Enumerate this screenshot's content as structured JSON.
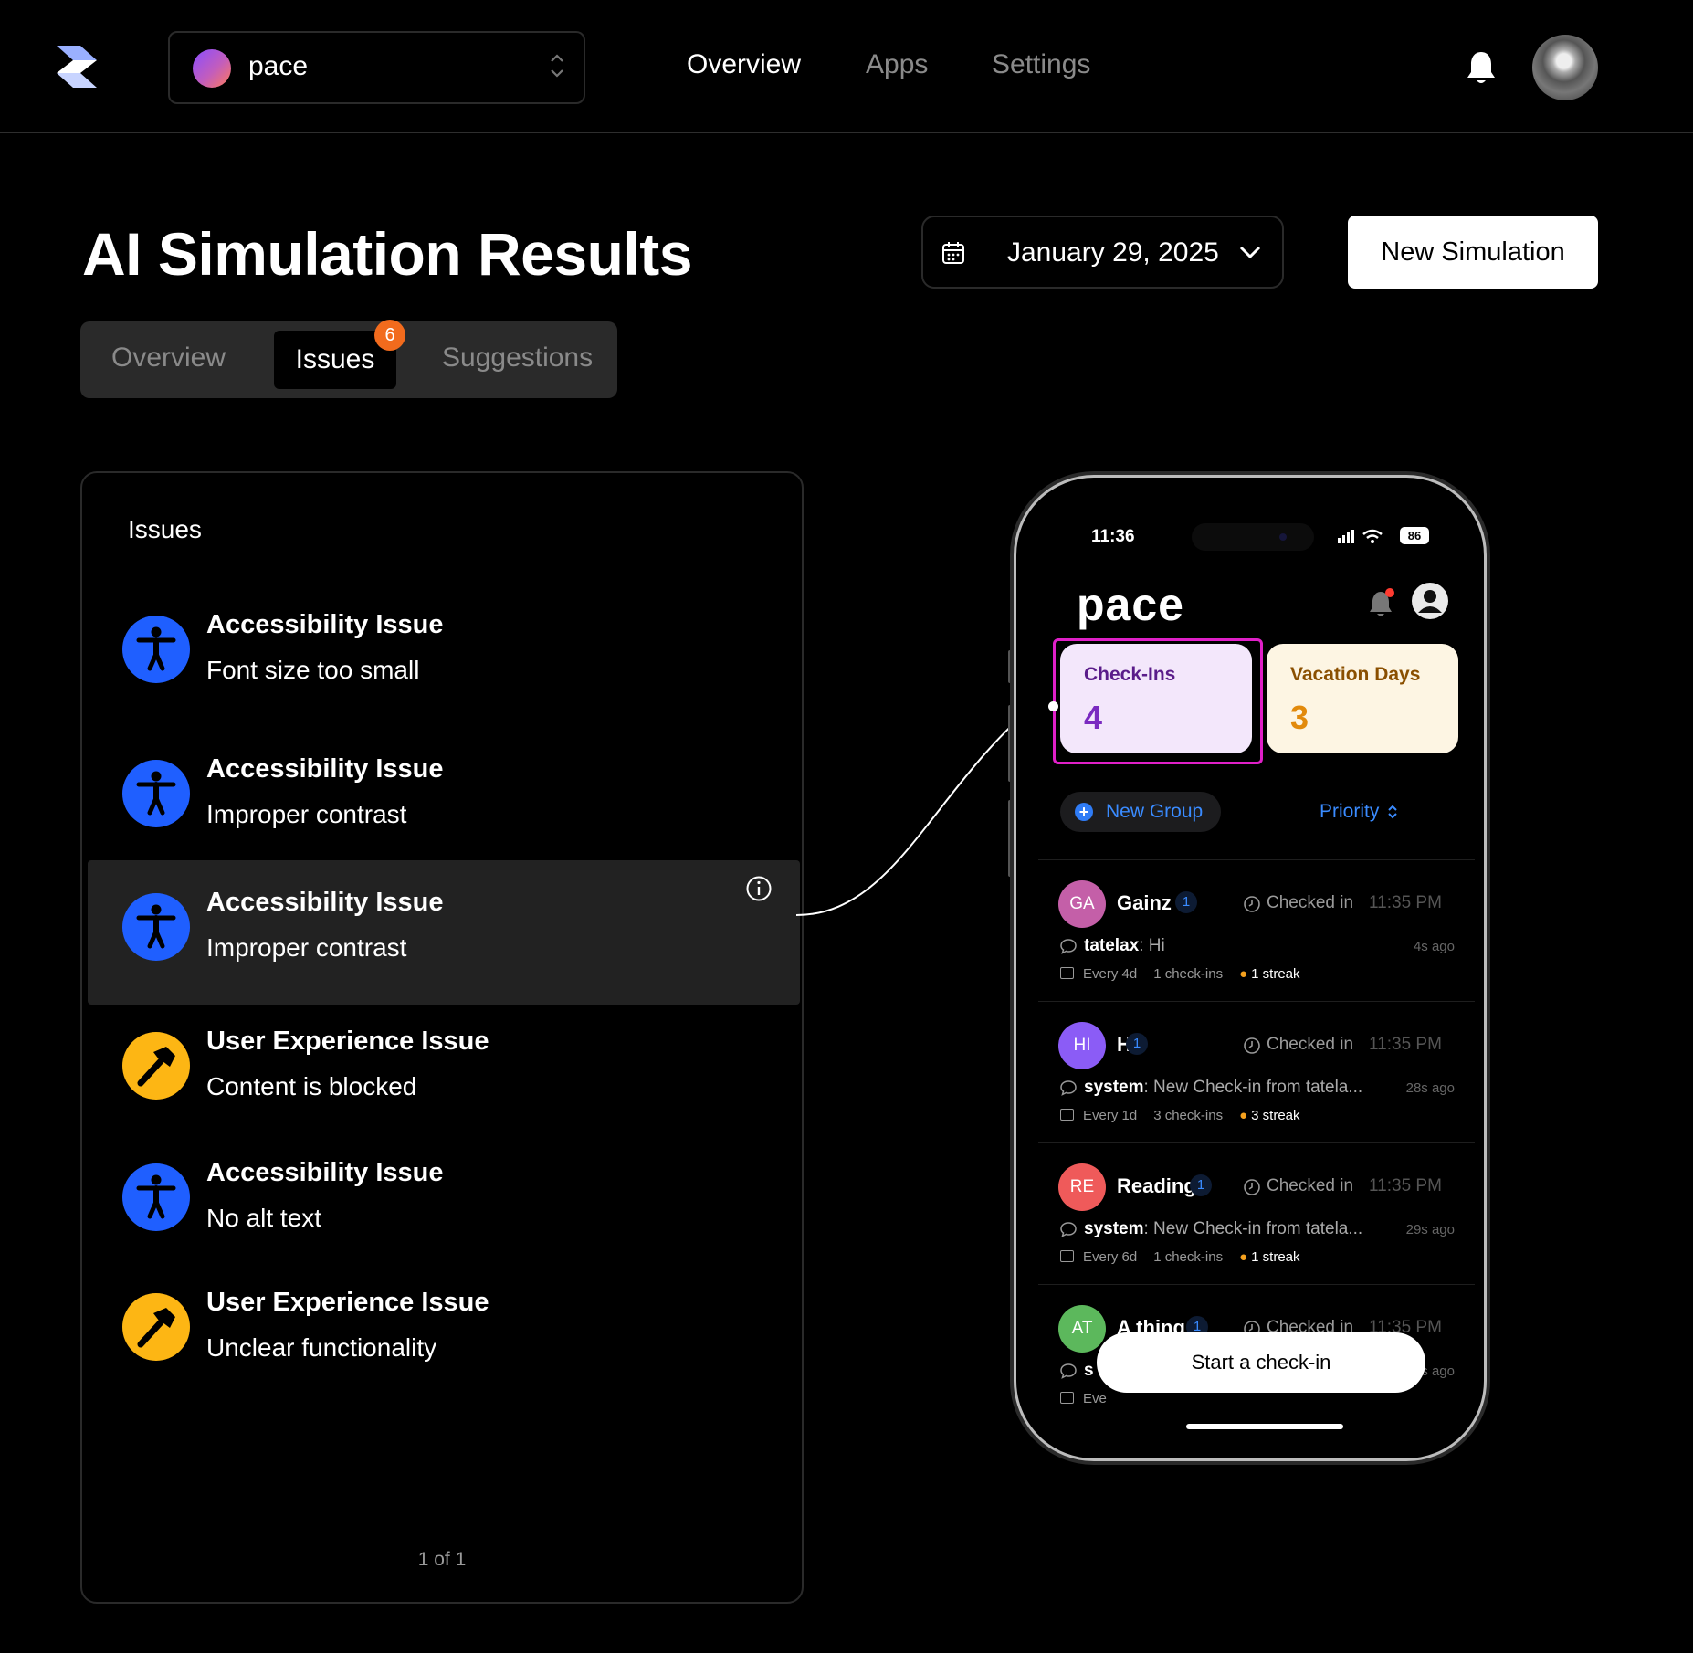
{
  "topbar": {
    "workspace_name": "pace",
    "nav": {
      "overview": "Overview",
      "apps": "Apps",
      "settings": "Settings"
    },
    "active_nav": "Overview"
  },
  "header": {
    "title": "AI Simulation Results",
    "date": "January 29, 2025",
    "new_simulation_label": "New Simulation"
  },
  "tabs": {
    "overview": "Overview",
    "issues": "Issues",
    "issues_badge": "6",
    "suggestions": "Suggestions",
    "active": "Issues"
  },
  "issues_panel": {
    "title": "Issues",
    "items": [
      {
        "type": "accessibility",
        "icon": "accessibility-icon",
        "title": "Accessibility Issue",
        "desc": "Font size too small"
      },
      {
        "type": "accessibility",
        "icon": "accessibility-icon",
        "title": "Accessibility Issue",
        "desc": "Improper contrast"
      },
      {
        "type": "accessibility",
        "icon": "accessibility-icon",
        "title": "Accessibility Issue",
        "desc": "Improper contrast",
        "selected": true
      },
      {
        "type": "ux",
        "icon": "hammer-icon",
        "title": "User Experience Issue",
        "desc": "Content is blocked"
      },
      {
        "type": "accessibility",
        "icon": "accessibility-icon",
        "title": "Accessibility Issue",
        "desc": "No alt text"
      },
      {
        "type": "ux",
        "icon": "hammer-icon",
        "title": "User Experience Issue",
        "desc": "Unclear functionality"
      }
    ],
    "pager": "1 of 1"
  },
  "phone": {
    "status_time": "11:36",
    "battery": "86",
    "app_name": "pace",
    "stats": {
      "checkins_label": "Check-Ins",
      "checkins_value": "4",
      "vacation_label": "Vacation Days",
      "vacation_value": "3"
    },
    "new_group_label": "New Group",
    "sort_label": "Priority",
    "groups": [
      {
        "initials": "GA",
        "name": "Gainz",
        "count": "1",
        "checked": "Checked in",
        "time": "11:35 PM",
        "sender": "tatelax",
        "message": ": Hi",
        "ago": "4s ago",
        "frequency": "Every 4d",
        "checkins": "1 check-ins",
        "streak": "1 streak",
        "color": "#c45fa8"
      },
      {
        "initials": "HI",
        "name": "Hi",
        "count": "1",
        "checked": "Checked in",
        "time": "11:35 PM",
        "sender": "system",
        "message": ": New Check-in from tatela...",
        "ago": "28s ago",
        "frequency": "Every 1d",
        "checkins": "3 check-ins",
        "streak": "3 streak",
        "color": "#8b5cf6"
      },
      {
        "initials": "RE",
        "name": "Reading",
        "count": "1",
        "checked": "Checked in",
        "time": "11:35 PM",
        "sender": "system",
        "message": ": New Check-in from tatela...",
        "ago": "29s ago",
        "frequency": "Every 6d",
        "checkins": "1 check-ins",
        "streak": "1 streak",
        "color": "#ef5a5a"
      },
      {
        "initials": "AT",
        "name": "A thing",
        "count": "1",
        "checked": "Checked in",
        "time": "11:35 PM",
        "sender": "s",
        "message": "",
        "ago": "s ago",
        "frequency": "Eve",
        "checkins": "",
        "streak": "",
        "color": "#5cb85c"
      }
    ],
    "start_checkin_label": "Start a check-in"
  },
  "colors": {
    "accent_blue": "#1f5fff",
    "warning_yellow": "#fdb614",
    "badge_orange": "#f26b1d",
    "highlight_magenta": "#e020c8",
    "link_blue": "#3a8bff"
  }
}
